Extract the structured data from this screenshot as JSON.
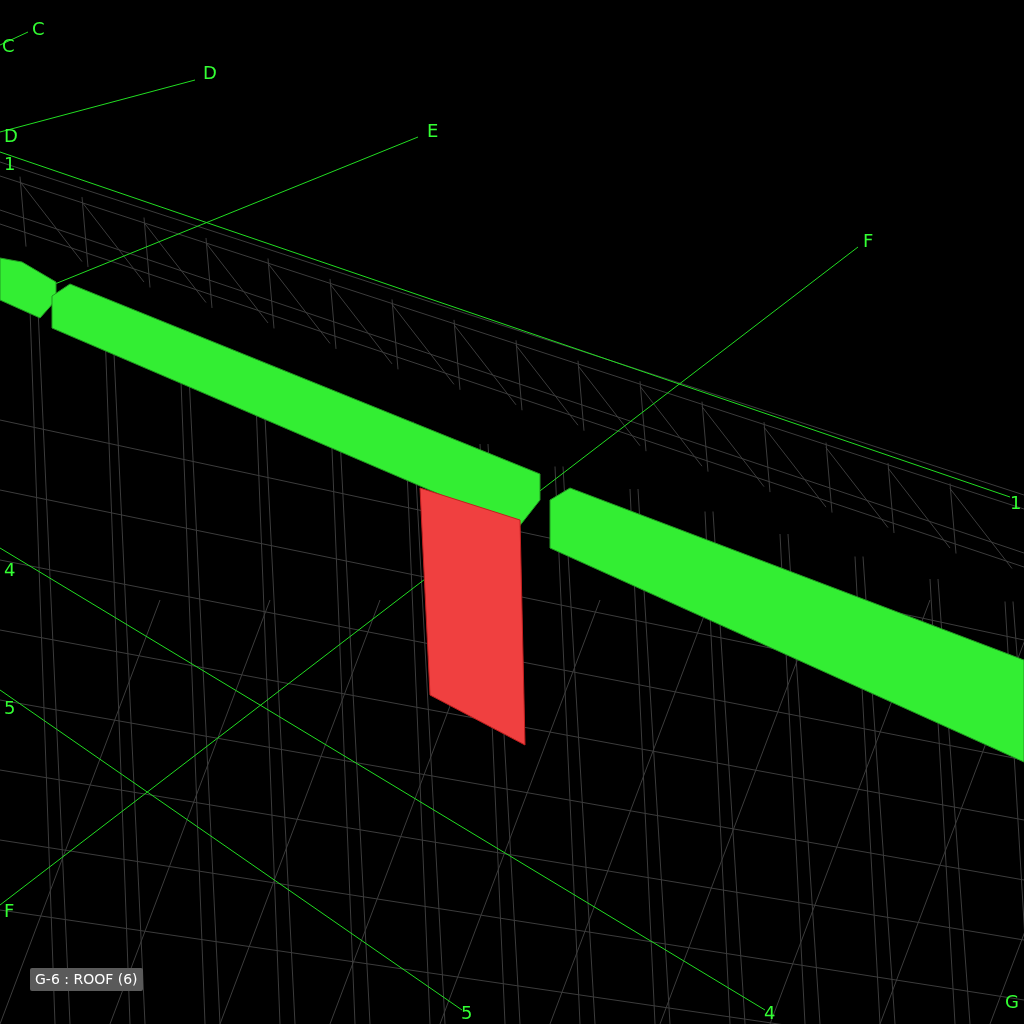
{
  "viewport": {
    "grid_labels": [
      "C",
      "C",
      "D",
      "D",
      "1",
      "E",
      "F",
      "1",
      "4",
      "5",
      "F",
      "5",
      "4",
      "G"
    ]
  },
  "view_label": "G-6 : ROOF (6)"
}
